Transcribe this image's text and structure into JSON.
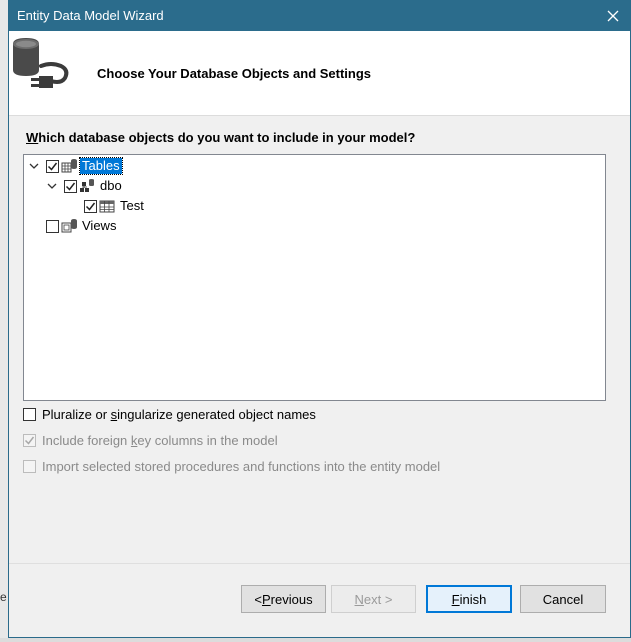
{
  "window": {
    "title": "Entity Data Model Wizard",
    "close_icon": "close-icon"
  },
  "header": {
    "icon": "database-plug-icon",
    "title": "Choose Your Database Objects and Settings"
  },
  "question": {
    "mnemonic": "W",
    "rest": "hich database objects do you want to include in your model?"
  },
  "tree": {
    "nodes": [
      {
        "label": "Tables",
        "checked": true,
        "expanded": true,
        "selected": true,
        "icon": "tables-icon"
      },
      {
        "label": "dbo",
        "checked": true,
        "expanded": true,
        "icon": "schema-icon"
      },
      {
        "label": "Test",
        "checked": true,
        "icon": "table-grid-icon"
      },
      {
        "label": "Views",
        "checked": false,
        "expanded": false,
        "icon": "views-icon"
      }
    ]
  },
  "options": {
    "pluralize": {
      "pre": "Pluralize or ",
      "mnemonic": "s",
      "post": "ingularize generated object names",
      "checked": false,
      "enabled": true
    },
    "foreign_keys": {
      "pre": "Include foreign ",
      "mnemonic": "k",
      "post": "ey columns in the model",
      "checked": true,
      "enabled": false
    },
    "stored_procs": {
      "pre": "Import selected stored procedures and functions into the entity model",
      "checked": false,
      "enabled": false
    }
  },
  "buttons": {
    "previous": {
      "pre": "< ",
      "mnemonic": "P",
      "post": "revious"
    },
    "next": {
      "pre": "",
      "mnemonic": "N",
      "post": "ext >"
    },
    "finish": {
      "mnemonic": "F",
      "post": "inish"
    },
    "cancel": "Cancel"
  },
  "background": {
    "partial_text": "e"
  },
  "colors": {
    "titlebar": "#2b6c8c",
    "selection": "#0078d7",
    "default_button_border": "#0078d7"
  }
}
